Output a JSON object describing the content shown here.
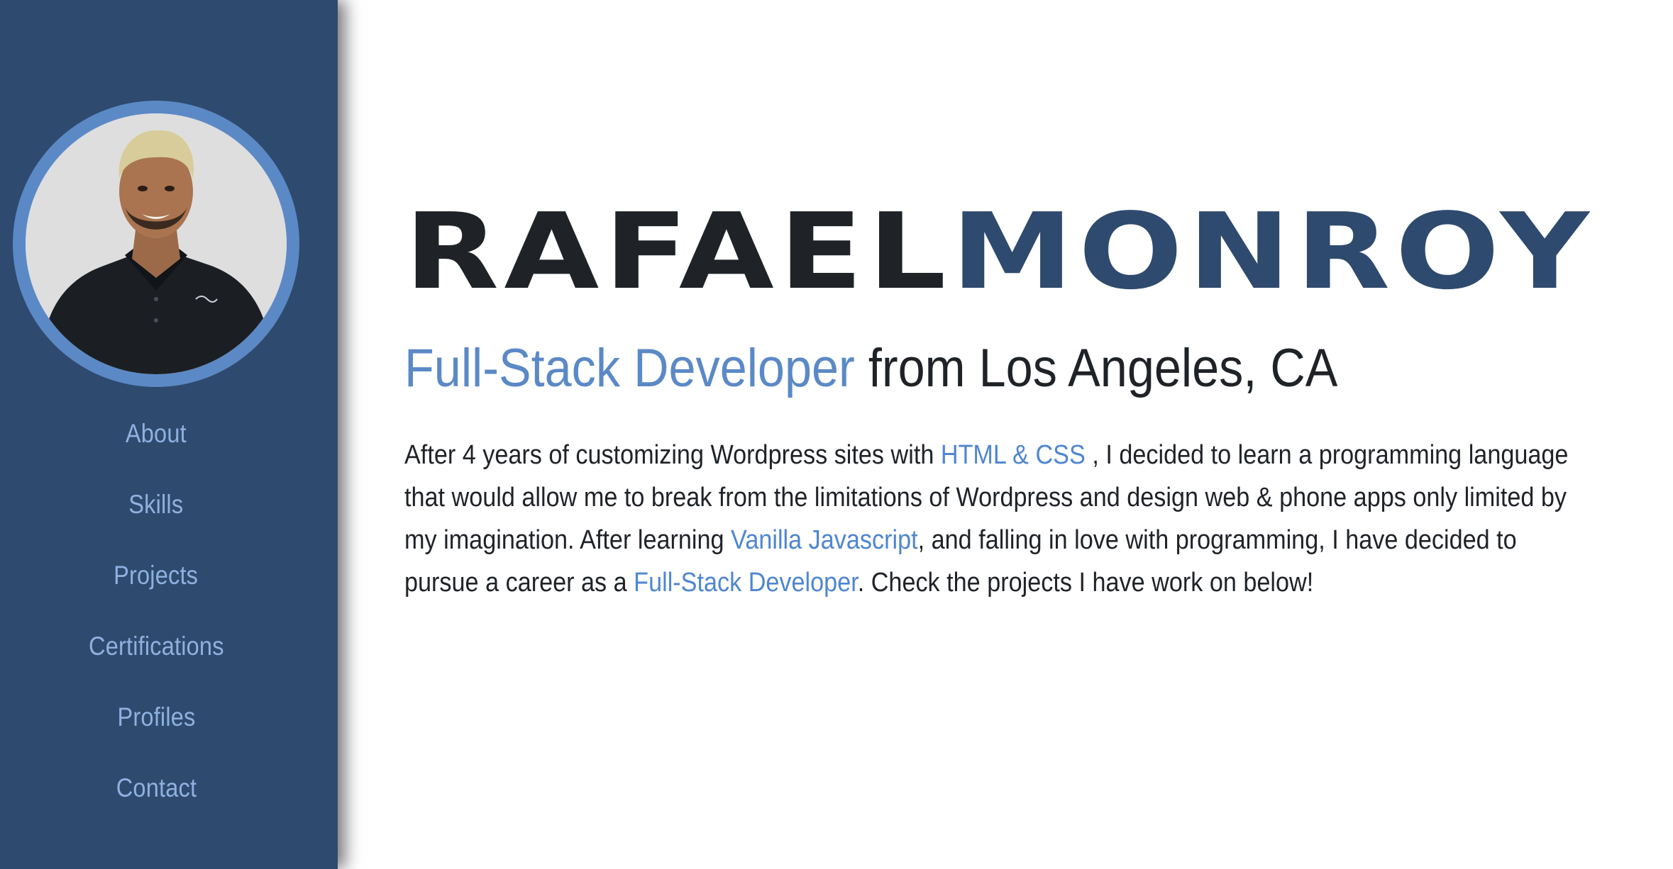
{
  "sidebar": {
    "avatar_alt": "Profile photo",
    "nav": [
      {
        "label": "About"
      },
      {
        "label": "Skills"
      },
      {
        "label": "Projects"
      },
      {
        "label": "Certifications"
      },
      {
        "label": "Profiles"
      },
      {
        "label": "Contact"
      }
    ]
  },
  "hero": {
    "first_name": "RAFAEL",
    "last_name": "MONROY",
    "role": "Full-Stack Developer",
    "location": " from Los Angeles, CA"
  },
  "bio": {
    "p1": "After 4 years of customizing Wordpress sites with ",
    "link1": "HTML & CSS",
    "p2": " , I decided to learn a programming language that would allow me to break from the limitations of Wordpress and design web & phone apps only limited by my imagination. After learning ",
    "link2": "Vanilla Javascript",
    "p3": ", and falling in love with programming, I have decided to pursue a career as a ",
    "link3": "Full-Stack Developer",
    "p4": ". Check the projects I have work on below!"
  },
  "colors": {
    "sidebar_bg": "#2e4a6e",
    "accent": "#5b89c6",
    "link": "#4f86d0",
    "text": "#1f2328"
  }
}
